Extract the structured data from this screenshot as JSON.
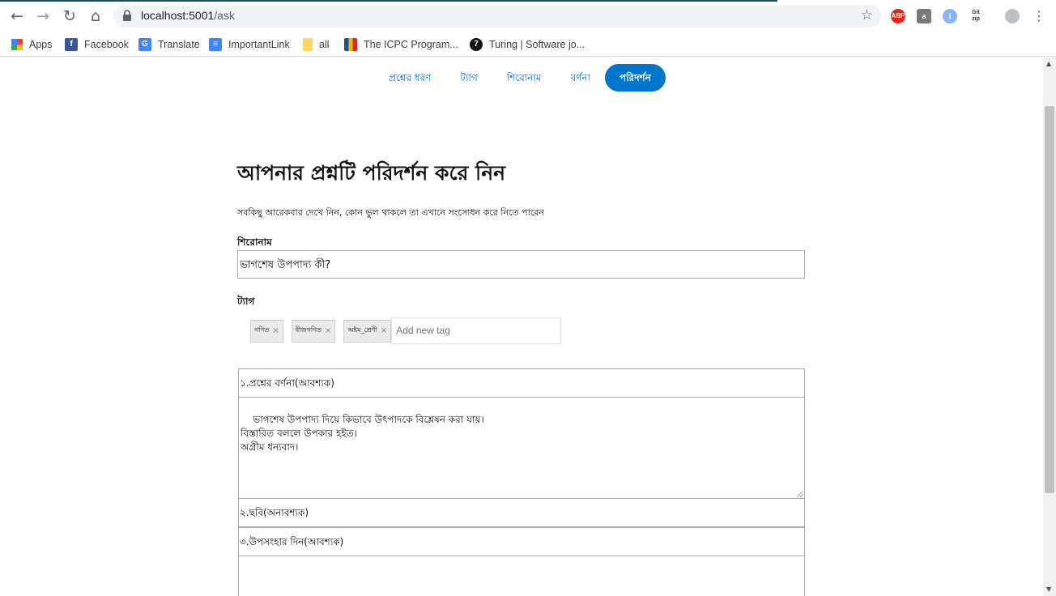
{
  "browser": {
    "url_host": "localhost:5001",
    "url_path": "/ask",
    "extensions": [
      "ABP",
      "a",
      "i",
      "Git zip"
    ],
    "bookmarks": [
      {
        "label": "Apps",
        "icon": "apps-grid-icon"
      },
      {
        "label": "Facebook",
        "icon": "facebook-icon"
      },
      {
        "label": "Translate",
        "icon": "translate-icon"
      },
      {
        "label": "ImportantLink",
        "icon": "doc-icon"
      },
      {
        "label": "all",
        "icon": "folder-icon"
      },
      {
        "label": "The ICPC Program...",
        "icon": "icpc-icon"
      },
      {
        "label": "Turing | Software jo...",
        "icon": "turing-icon"
      }
    ]
  },
  "steps": [
    {
      "label": "প্রশ্নের ধরণ",
      "active": false
    },
    {
      "label": "ট্যাগ",
      "active": false
    },
    {
      "label": "শিরোনাম",
      "active": false
    },
    {
      "label": "বর্ণনা",
      "active": false
    },
    {
      "label": "পরিদর্শন",
      "active": true
    }
  ],
  "heading": "আপনার প্রশ্নটি পরিদর্শন করে নিন",
  "subheading": "সবকিছু আরেকবার দেখে নিন, কোন ভুল থাকলে তা এখানে সংসোধন করে নিতে পারেন",
  "title_section": {
    "label": "শিরোনাম",
    "value": "ভাগশেষ উপপাদ্য কী?"
  },
  "tag_section": {
    "label": "ট্যাগ",
    "tags": [
      "গণিত",
      "বীজগণিত",
      "অষ্টম_শ্রেণী"
    ],
    "remove_symbol": "×",
    "input_placeholder": "Add new tag"
  },
  "sections": {
    "description_label": "১.প্রশ্নের বর্ণনা(আবশ্যক)",
    "description_value": "ভাগশেষ উপপাদ্য দিয়ে কিভাবে উৎপাদকে বিশ্লেষন করা যায়।\nবিস্তারিত বললে উপকার হইত।\nঅগ্রীম ধন্যবাদ।",
    "image_label": "২.ছবি(অনাবশ্যক)",
    "summary_label": "৩.উপসংহার দিন(আবশ্যক)"
  },
  "colors": {
    "accent": "#0077cc",
    "link": "#0b69c7"
  }
}
